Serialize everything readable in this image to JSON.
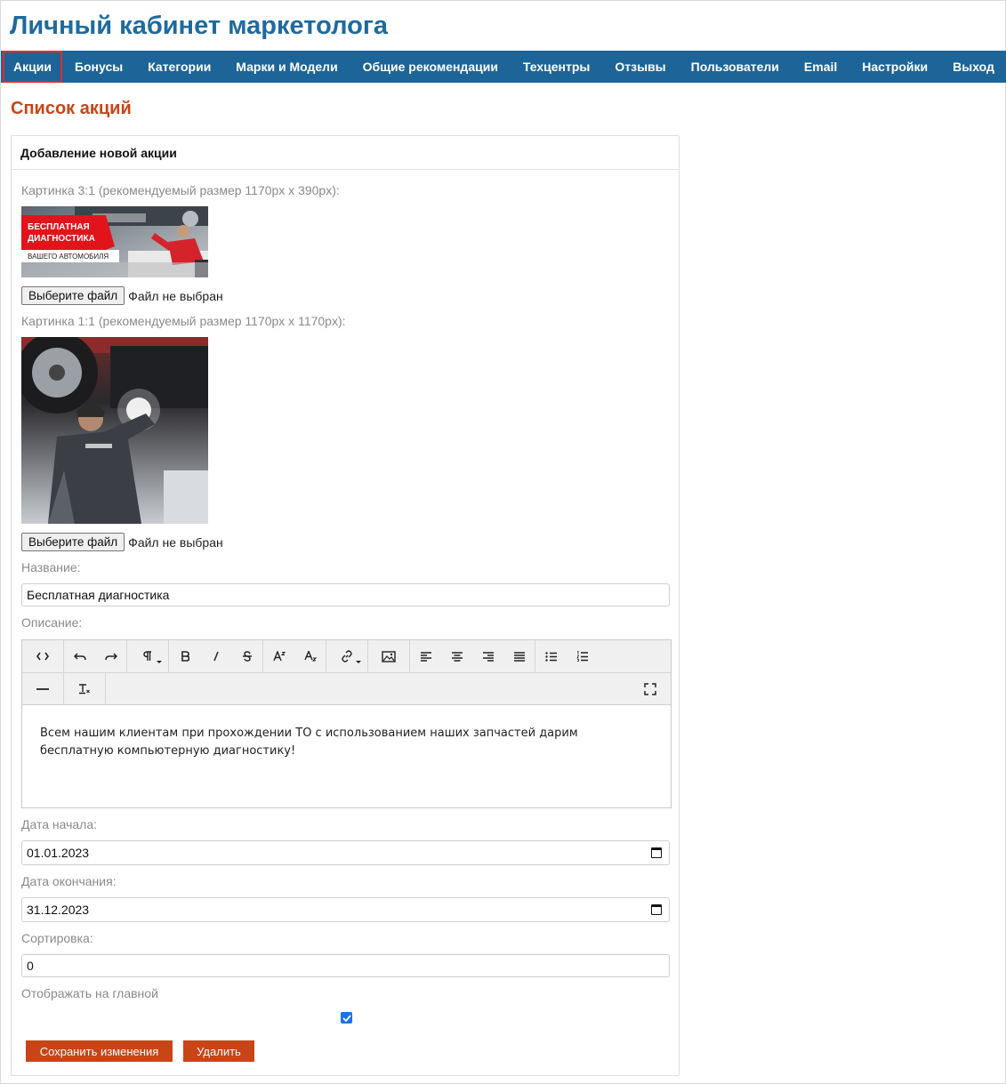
{
  "app": {
    "title": "Личный кабинет маркетолога"
  },
  "nav": {
    "items": [
      {
        "label": "Акции",
        "active": true
      },
      {
        "label": "Бонусы"
      },
      {
        "label": "Категории"
      },
      {
        "label": "Марки и Модели"
      },
      {
        "label": "Общие рекомендации"
      },
      {
        "label": "Техцентры"
      },
      {
        "label": "Отзывы"
      },
      {
        "label": "Пользователи"
      },
      {
        "label": "Email"
      },
      {
        "label": "Настройки"
      },
      {
        "label": "Выход"
      }
    ]
  },
  "page": {
    "title": "Список акций"
  },
  "form": {
    "heading": "Добавление новой акции",
    "image_wide": {
      "label": "Картинка 3:1 (рекомендуемый размер 1170px x 390px):",
      "banner_line1": "БЕСПЛАТНАЯ",
      "banner_line2": "ДИАГНОСТИКА",
      "banner_line3": "ВАШЕГО АВТОМОБИЛЯ",
      "file_button": "Выберите файл",
      "file_status": "Файл не выбран"
    },
    "image_square": {
      "label": "Картинка 1:1 (рекомендуемый размер 1170px x 1170px):",
      "file_button": "Выберите файл",
      "file_status": "Файл не выбран"
    },
    "name": {
      "label": "Название:",
      "value": "Бесплатная диагностика"
    },
    "description": {
      "label": "Описание:",
      "text": "Всем нашим клиентам при прохождении ТО с использованием наших запчастей дарим бесплатную компьютерную диагностику!",
      "toolbar_icons": [
        "code-view-icon",
        "undo-icon",
        "redo-icon",
        "paragraph-format-icon",
        "bold-icon",
        "italic-icon",
        "strikethrough-icon",
        "superscript-icon",
        "subscript-icon",
        "link-icon",
        "image-icon",
        "align-left-icon",
        "align-center-icon",
        "align-right-icon",
        "align-justify-icon",
        "unordered-list-icon",
        "ordered-list-icon",
        "horizontal-line-icon",
        "clear-format-icon",
        "fullscreen-icon"
      ]
    },
    "start_date": {
      "label": "Дата начала:",
      "value": "01.01.2023"
    },
    "end_date": {
      "label": "Дата окончания:",
      "value": "31.12.2023"
    },
    "sort": {
      "label": "Сортировка:",
      "value": "0"
    },
    "show_on_main": {
      "label": "Отображать на главной",
      "checked": true
    },
    "save_button": "Сохранить изменения",
    "delete_button": "Удалить"
  },
  "colors": {
    "brand": "#1d6598",
    "title": "#1e6aa0",
    "accent": "#c94417",
    "active_outline": "#e32a2a",
    "checkbox": "#1a73e8"
  }
}
